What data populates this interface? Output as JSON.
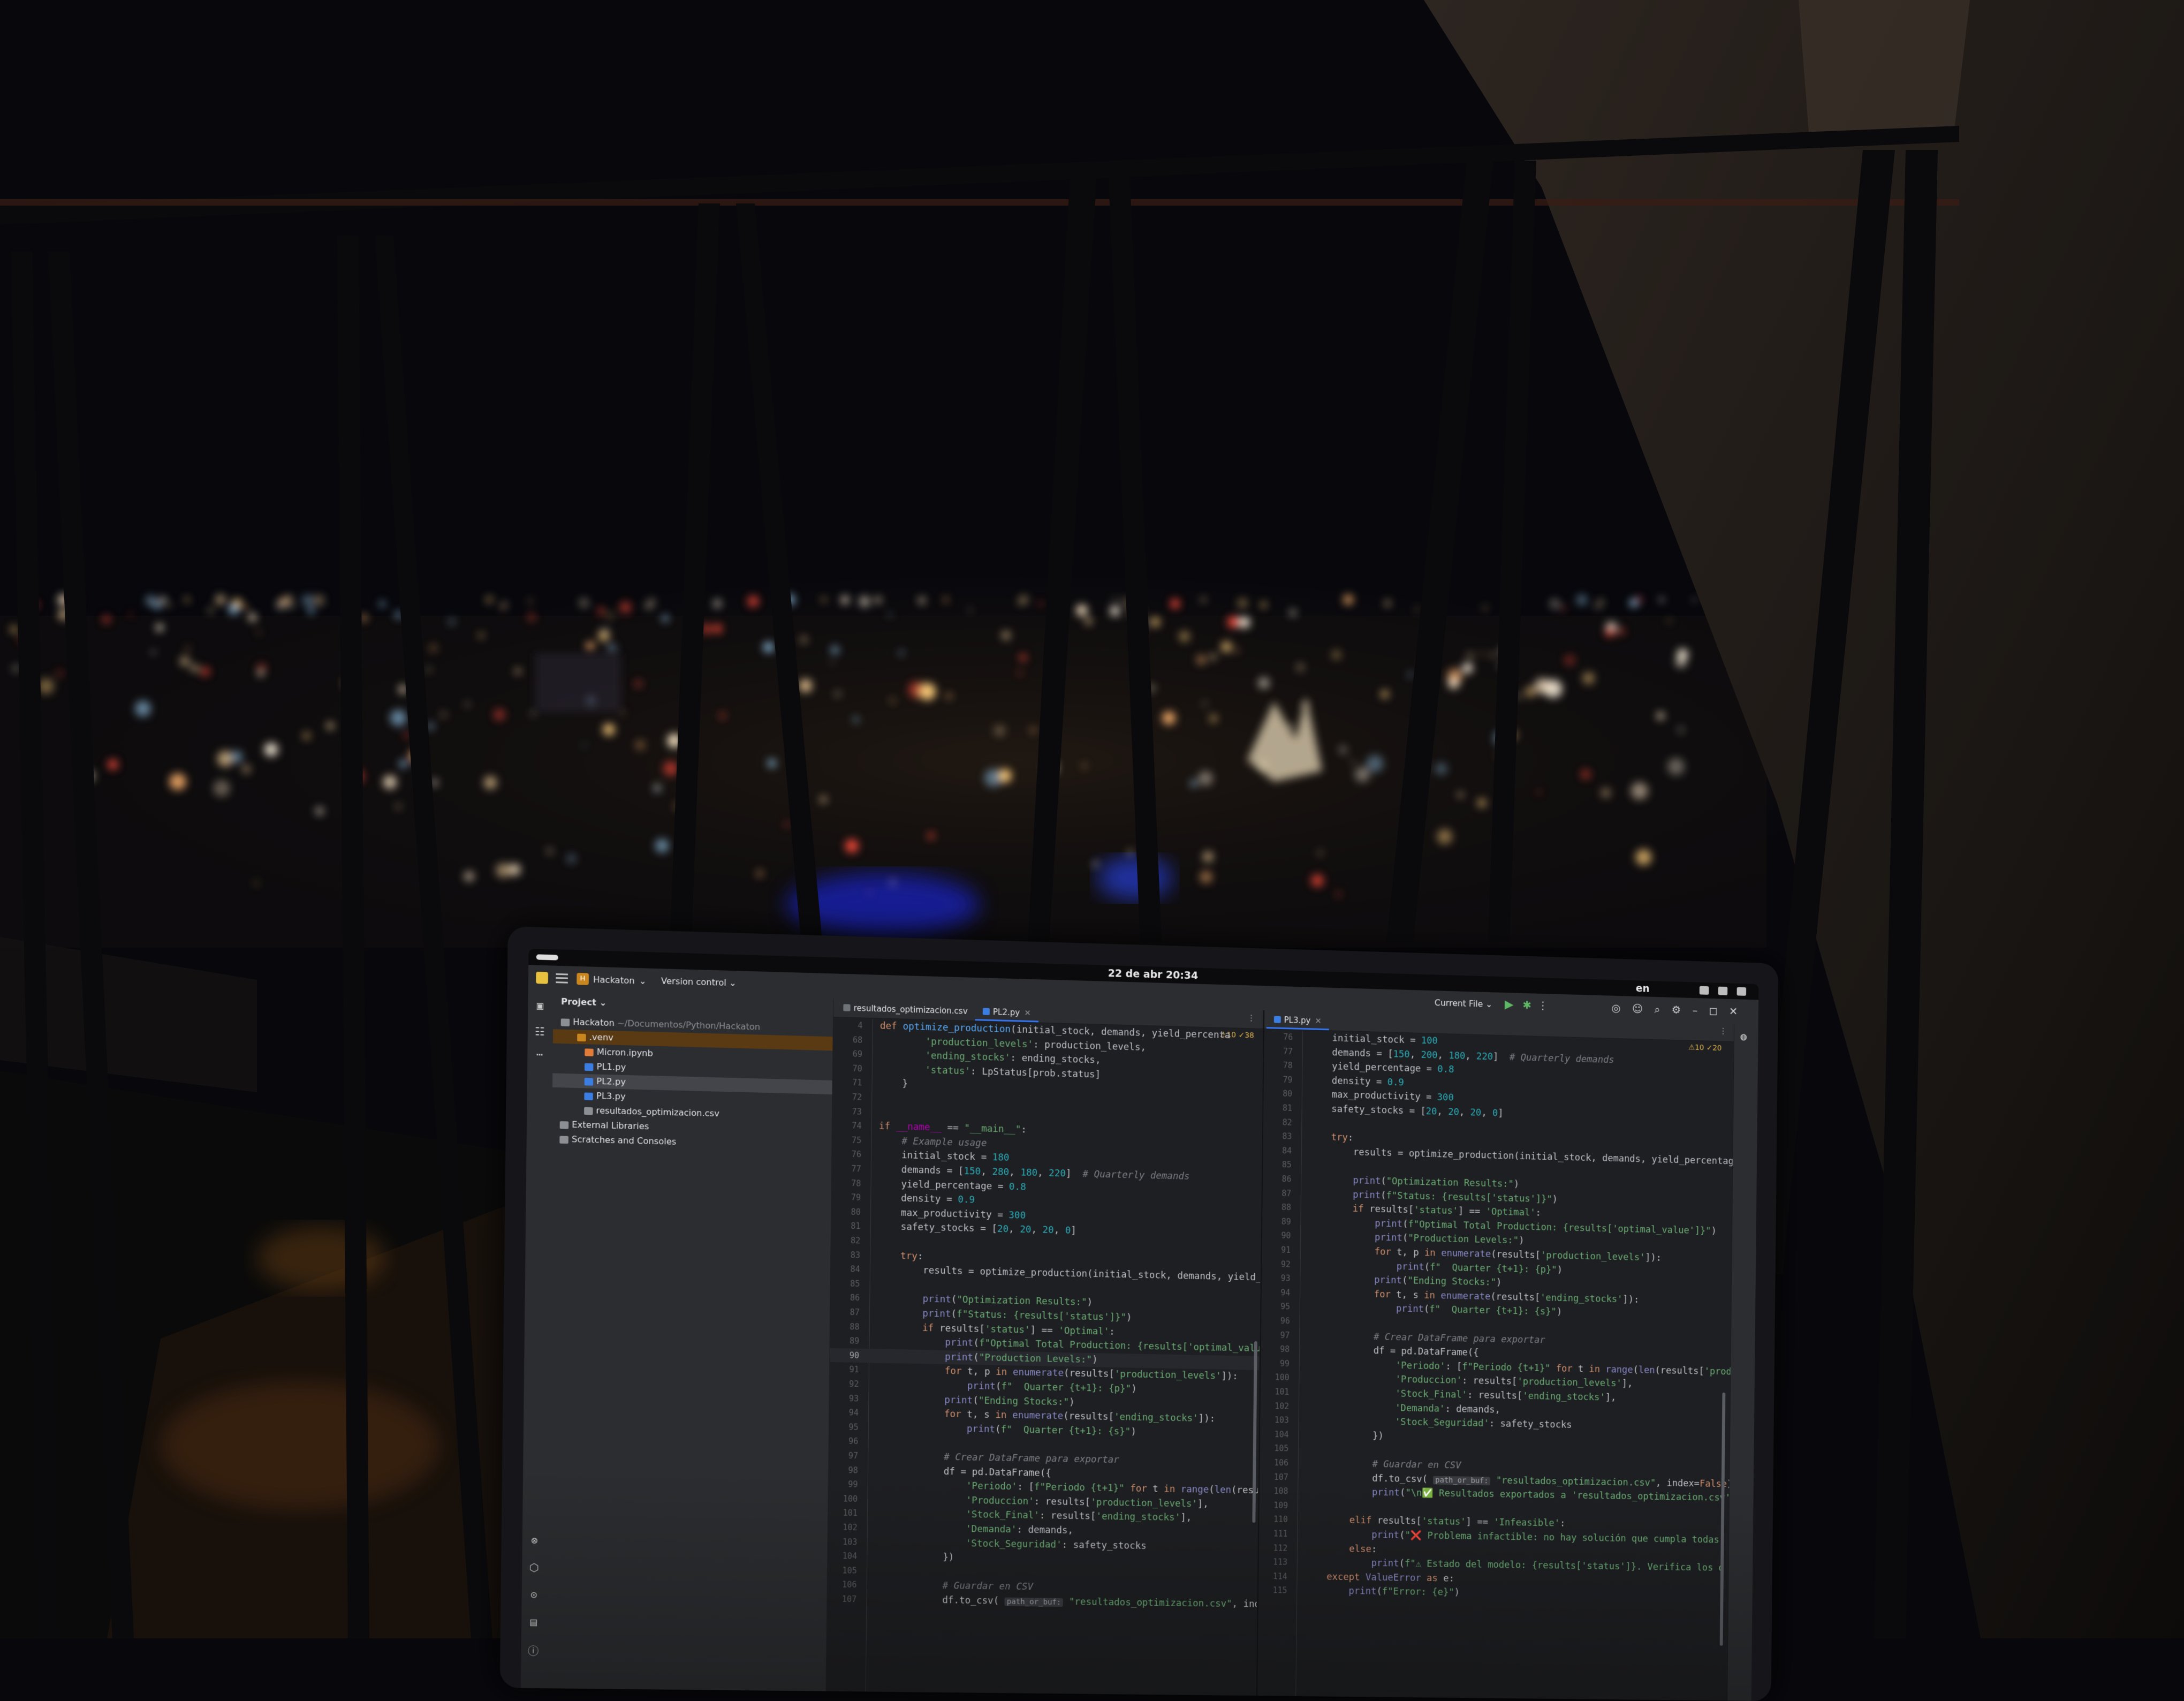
{
  "system_bar": {
    "clock": "22 de abr  20:34",
    "language": "en"
  },
  "ide": {
    "project_name": "Hackaton",
    "project_badge": "H",
    "version_control": "Version control",
    "run_config": "Current File",
    "project_panel_title": "Project",
    "tree": [
      {
        "label": "Hackaton",
        "detail": "~/Documentos/Python/Hackaton",
        "kind": "folder"
      },
      {
        "label": ".venv",
        "kind": "venv"
      },
      {
        "label": "Micron.ipynb",
        "kind": "notebook"
      },
      {
        "label": "PL1.py",
        "kind": "py"
      },
      {
        "label": "PL2.py",
        "kind": "py",
        "selected": true
      },
      {
        "label": "PL3.py",
        "kind": "py"
      },
      {
        "label": "resultados_optimizacion.csv",
        "kind": "csv"
      },
      {
        "label": "External Libraries",
        "kind": "lib"
      },
      {
        "label": "Scratches and Consoles",
        "kind": "scratch"
      }
    ],
    "left_editor": {
      "tabs": [
        "resultados_optimizacion.csv",
        "PL2.py"
      ],
      "active_tab": "PL2.py",
      "inspection": "⚠10 ✓38",
      "lines": [
        {
          "n": "4",
          "html": "<span class='kw'>def</span> <span class='fn'>optimize_production</span>(initial_stock, demands, yield_percenta"
        },
        {
          "n": "68",
          "html": "        <span class='str'>'production_levels'</span>: production_levels,"
        },
        {
          "n": "69",
          "html": "        <span class='str'>'ending_stocks'</span>: ending_stocks,"
        },
        {
          "n": "70",
          "html": "        <span class='str'>'status'</span>: LpStatus[prob.status]"
        },
        {
          "n": "71",
          "html": "    }"
        },
        {
          "n": "72",
          "html": ""
        },
        {
          "n": "73",
          "html": ""
        },
        {
          "n": "74",
          "html": "<span class='kw'>if</span> <span class='dunder'>__name__</span> == <span class='str'>\"__main__\"</span>:"
        },
        {
          "n": "75",
          "html": "    <span class='cm'># Example usage</span>"
        },
        {
          "n": "76",
          "html": "    initial_stock = <span class='num2'>180</span>"
        },
        {
          "n": "77",
          "html": "    demands = [<span class='num2'>150</span>, <span class='num2'>280</span>, <span class='num2'>180</span>, <span class='num2'>220</span>]  <span class='cm'># Quarterly demands</span>"
        },
        {
          "n": "78",
          "html": "    yield_percentage = <span class='num2'>0.8</span>"
        },
        {
          "n": "79",
          "html": "    density = <span class='num2'>0.9</span>"
        },
        {
          "n": "80",
          "html": "    max_productivity = <span class='num2'>300</span>"
        },
        {
          "n": "81",
          "html": "    safety_stocks = [<span class='num2'>20</span>, <span class='num2'>20</span>, <span class='num2'>20</span>, <span class='num2'>0</span>]"
        },
        {
          "n": "82",
          "html": ""
        },
        {
          "n": "83",
          "html": "    <span class='kw'>try</span>:"
        },
        {
          "n": "84",
          "html": "        results = optimize_production(initial_stock, demands, yield_percentag"
        },
        {
          "n": "85",
          "html": ""
        },
        {
          "n": "86",
          "html": "        <span class='bi'>print</span>(<span class='str'>\"Optimization Results:\"</span>)"
        },
        {
          "n": "87",
          "html": "        <span class='bi'>print</span>(<span class='str'>f\"Status: {results['status']}\"</span>)"
        },
        {
          "n": "88",
          "html": "        <span class='kw'>if</span> results[<span class='str'>'status'</span>] == <span class='str'>'Optimal'</span>:"
        },
        {
          "n": "89",
          "html": "            <span class='bi'>print</span>(<span class='str'>f\"Optimal Total Production: {results['optimal_value']}\"</span>)"
        },
        {
          "n": "90",
          "html": "            <span class='bi'>print</span>(<span class='str'>\"Production Levels:\"</span>)",
          "current": true
        },
        {
          "n": "91",
          "html": "            <span class='kw'>for</span> t, p <span class='kw'>in</span> <span class='bi'>enumerate</span>(results[<span class='str'>'production_levels'</span>]):"
        },
        {
          "n": "92",
          "html": "                <span class='bi'>print</span>(<span class='str'>f\"  Quarter {t+1}: {p}\"</span>)"
        },
        {
          "n": "93",
          "html": "            <span class='bi'>print</span>(<span class='str'>\"Ending Stocks:\"</span>)"
        },
        {
          "n": "94",
          "html": "            <span class='kw'>for</span> t, s <span class='kw'>in</span> <span class='bi'>enumerate</span>(results[<span class='str'>'ending_stocks'</span>]):"
        },
        {
          "n": "95",
          "html": "                <span class='bi'>print</span>(<span class='str'>f\"  Quarter {t+1}: {s}\"</span>)"
        },
        {
          "n": "96",
          "html": ""
        },
        {
          "n": "97",
          "html": "            <span class='cm'># Crear DataFrame para exportar</span>"
        },
        {
          "n": "98",
          "html": "            df = pd.DataFrame({"
        },
        {
          "n": "99",
          "html": "                <span class='str'>'Periodo'</span>: [<span class='str'>f\"Periodo {t+1}\"</span> <span class='kw'>for</span> t <span class='kw'>in</span> <span class='bi'>range</span>(<span class='bi'>len</span>(results[<span class='str'>'prod</span>"
        },
        {
          "n": "100",
          "html": "                <span class='str'>'Produccion'</span>: results[<span class='str'>'production_levels'</span>],"
        },
        {
          "n": "101",
          "html": "                <span class='str'>'Stock_Final'</span>: results[<span class='str'>'ending_stocks'</span>],"
        },
        {
          "n": "102",
          "html": "                <span class='str'>'Demanda'</span>: demands,"
        },
        {
          "n": "103",
          "html": "                <span class='str'>'Stock_Seguridad'</span>: safety_stocks"
        },
        {
          "n": "104",
          "html": "            })"
        },
        {
          "n": "105",
          "html": ""
        },
        {
          "n": "106",
          "html": "            <span class='cm'># Guardar en CSV</span>"
        },
        {
          "n": "107",
          "html": "            df.to_csv( <span class='hint'>path_or_buf:</span> <span class='str'>\"resultados_optimizacion.csv\"</span>, index=<span class='kw'>False</span>)"
        }
      ]
    },
    "right_editor": {
      "tabs": [
        "PL3.py"
      ],
      "active_tab": "PL3.py",
      "inspection": "⚠10 ✓20",
      "lines": [
        {
          "n": "76",
          "html": "    initial_stock = <span class='num2'>100</span>"
        },
        {
          "n": "77",
          "html": "    demands = [<span class='num2'>150</span>, <span class='num2'>200</span>, <span class='num2'>180</span>, <span class='num2'>220</span>]  <span class='cm'># Quarterly demands</span>"
        },
        {
          "n": "78",
          "html": "    yield_percentage = <span class='num2'>0.8</span>"
        },
        {
          "n": "79",
          "html": "    density = <span class='num2'>0.9</span>"
        },
        {
          "n": "80",
          "html": "    max_productivity = <span class='num2'>300</span>"
        },
        {
          "n": "81",
          "html": "    safety_stocks = [<span class='num2'>20</span>, <span class='num2'>20</span>, <span class='num2'>20</span>, <span class='num2'>0</span>]"
        },
        {
          "n": "82",
          "html": ""
        },
        {
          "n": "83",
          "html": "    <span class='kw'>try</span>:"
        },
        {
          "n": "84",
          "html": "        results = optimize_production(initial_stock, demands, yield_percentag"
        },
        {
          "n": "85",
          "html": ""
        },
        {
          "n": "86",
          "html": "        <span class='bi'>print</span>(<span class='str'>\"Optimization Results:\"</span>)"
        },
        {
          "n": "87",
          "html": "        <span class='bi'>print</span>(<span class='str'>f\"Status: {results['status']}\"</span>)"
        },
        {
          "n": "88",
          "html": "        <span class='kw'>if</span> results[<span class='str'>'status'</span>] == <span class='str'>'Optimal'</span>:"
        },
        {
          "n": "89",
          "html": "            <span class='bi'>print</span>(<span class='str'>f\"Optimal Total Production: {results['optimal_value']}\"</span>)"
        },
        {
          "n": "90",
          "html": "            <span class='bi'>print</span>(<span class='str'>\"Production Levels:\"</span>)"
        },
        {
          "n": "91",
          "html": "            <span class='kw'>for</span> t, p <span class='kw'>in</span> <span class='bi'>enumerate</span>(results[<span class='str'>'production_levels'</span>]):"
        },
        {
          "n": "92",
          "html": "                <span class='bi'>print</span>(<span class='str'>f\"  Quarter {t+1}: {p}\"</span>)"
        },
        {
          "n": "93",
          "html": "            <span class='bi'>print</span>(<span class='str'>\"Ending Stocks:\"</span>)"
        },
        {
          "n": "94",
          "html": "            <span class='kw'>for</span> t, s <span class='kw'>in</span> <span class='bi'>enumerate</span>(results[<span class='str'>'ending_stocks'</span>]):"
        },
        {
          "n": "95",
          "html": "                <span class='bi'>print</span>(<span class='str'>f\"  Quarter {t+1}: {s}\"</span>)"
        },
        {
          "n": "96",
          "html": ""
        },
        {
          "n": "97",
          "html": "            <span class='cm'># Crear DataFrame para exportar</span>"
        },
        {
          "n": "98",
          "html": "            df = pd.DataFrame({"
        },
        {
          "n": "99",
          "html": "                <span class='str'>'Periodo'</span>: [<span class='str'>f\"Periodo {t+1}\"</span> <span class='kw'>for</span> t <span class='kw'>in</span> <span class='bi'>range</span>(<span class='bi'>len</span>(results[<span class='str'>'prod</span>"
        },
        {
          "n": "100",
          "html": "                <span class='str'>'Produccion'</span>: results[<span class='str'>'production_levels'</span>],"
        },
        {
          "n": "101",
          "html": "                <span class='str'>'Stock_Final'</span>: results[<span class='str'>'ending_stocks'</span>],"
        },
        {
          "n": "102",
          "html": "                <span class='str'>'Demanda'</span>: demands,"
        },
        {
          "n": "103",
          "html": "                <span class='str'>'Stock_Seguridad'</span>: safety_stocks"
        },
        {
          "n": "104",
          "html": "            })"
        },
        {
          "n": "105",
          "html": ""
        },
        {
          "n": "106",
          "html": "            <span class='cm'># Guardar en CSV</span>"
        },
        {
          "n": "107",
          "html": "            df.to_csv( <span class='hint'>path_or_buf:</span> <span class='str'>\"resultados_optimizacion.csv\"</span>, index=<span class='kw'>False</span>)"
        },
        {
          "n": "108",
          "html": "            <span class='bi'>print</span>(<span class='str'>\"\\n✅ Resultados exportados a 'resultados_optimizacion.csv'</span>"
        },
        {
          "n": "109",
          "html": ""
        },
        {
          "n": "110",
          "html": "        <span class='kw'>elif</span> results[<span class='str'>'status'</span>] == <span class='str'>'Infeasible'</span>:"
        },
        {
          "n": "111",
          "html": "            <span class='bi'>print</span>(<span class='str'>\"❌ Problema infactible: no hay solución que cumpla todas</span>"
        },
        {
          "n": "112",
          "html": "        <span class='kw'>else</span>:"
        },
        {
          "n": "113",
          "html": "            <span class='bi'>print</span>(<span class='str'>f\"⚠ Estado del modelo: {results['status']}. Verifica los d</span>"
        },
        {
          "n": "114",
          "html": "    <span class='kw'>except</span> <span class='bi'>ValueError</span> <span class='kw'>as</span> e:"
        },
        {
          "n": "115",
          "html": "        <span class='bi'>print</span>(<span class='str'>f\"Error: {e}\"</span>)"
        }
      ]
    }
  },
  "colors": {
    "night_sky": "#07070c",
    "ide_background": "#1e1f22",
    "ide_panel": "#2b2d30",
    "accent": "#3574f0"
  }
}
